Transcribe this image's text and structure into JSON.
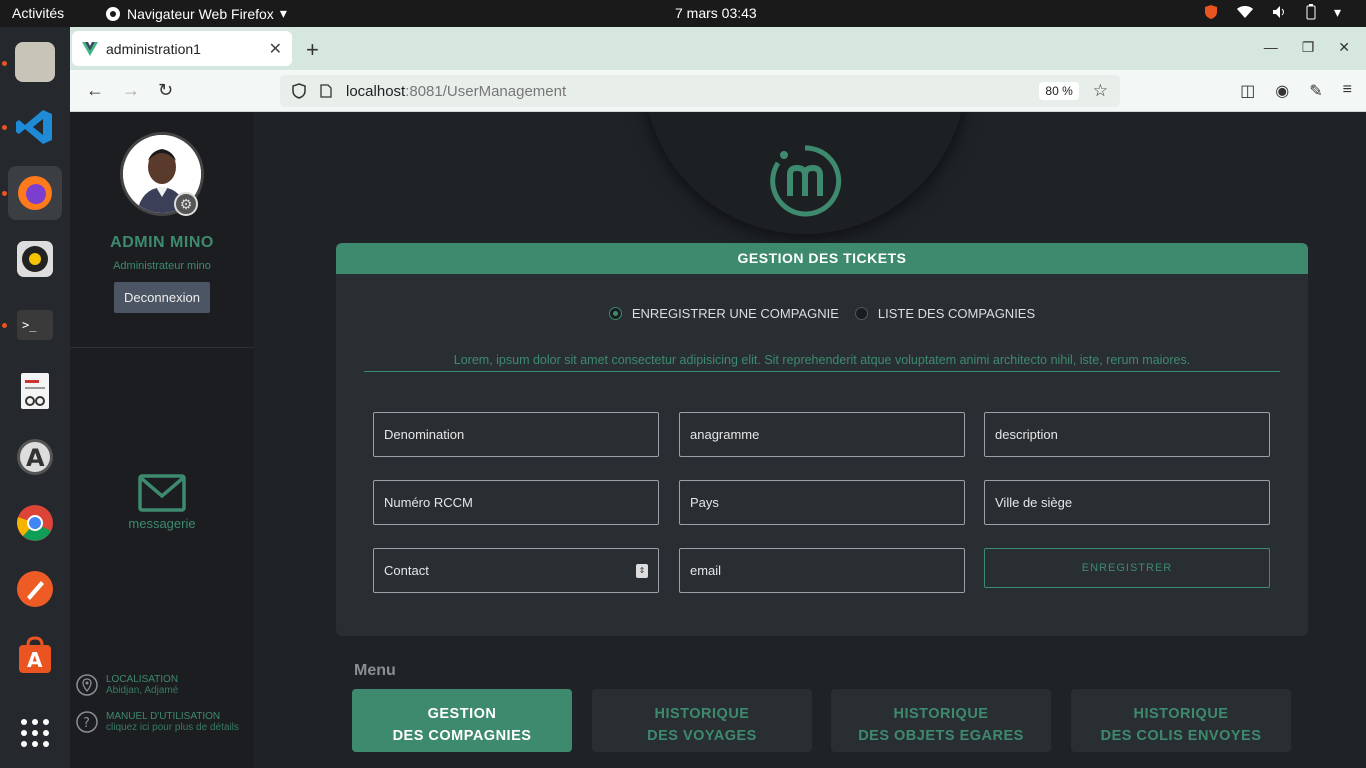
{
  "system": {
    "activities": "Activités",
    "app_menu": "Navigateur Web Firefox",
    "clock": "7 mars  03:43"
  },
  "browser": {
    "tab_title": "administration1",
    "url_host": "localhost",
    "url_path": ":8081/UserManagement",
    "zoom": "80 %"
  },
  "sidebar": {
    "admin_name": "ADMIN MINO",
    "admin_role": "Administrateur mino",
    "logout_label": "Deconnexion",
    "messaging_label": "messagerie",
    "location_title": "LOCALISATION",
    "location_value": "Abidjan, Adjamé",
    "manual_title": "MANUEL D'UTILISATION",
    "manual_sub": "cliquez ici pour plus de détails"
  },
  "card": {
    "title": "GESTION DES TICKETS",
    "radio_register": "ENREGISTRER UNE COMPAGNIE",
    "radio_list": "LISTE DES COMPAGNIES",
    "selected_radio": "register",
    "lorem": "Lorem, ipsum dolor sit amet consectetur adipisicing elit. Sit reprehenderit atque voluptatem animi architecto nihil, iste, rerum maiores.",
    "fields": {
      "denomination": "Denomination",
      "anagramme": "anagramme",
      "description": "description",
      "rccm": "Numéro RCCM",
      "pays": "Pays",
      "ville": "Ville de siège",
      "contact": "Contact",
      "email": "email"
    },
    "save_label": "ENREGISTRER"
  },
  "menu": {
    "title": "Menu",
    "items": [
      {
        "line1": "GESTION",
        "line2": "DES COMPAGNIES"
      },
      {
        "line1": "HISTORIQUE",
        "line2": "DES VOYAGES"
      },
      {
        "line1": "HISTORIQUE",
        "line2": "DES OBJETS EGARES"
      },
      {
        "line1": "HISTORIQUE",
        "line2": "DES COLIS ENVOYES"
      }
    ]
  },
  "colors": {
    "accent": "#3e8a6e",
    "panel": "#292e33",
    "background": "#1f2327"
  }
}
